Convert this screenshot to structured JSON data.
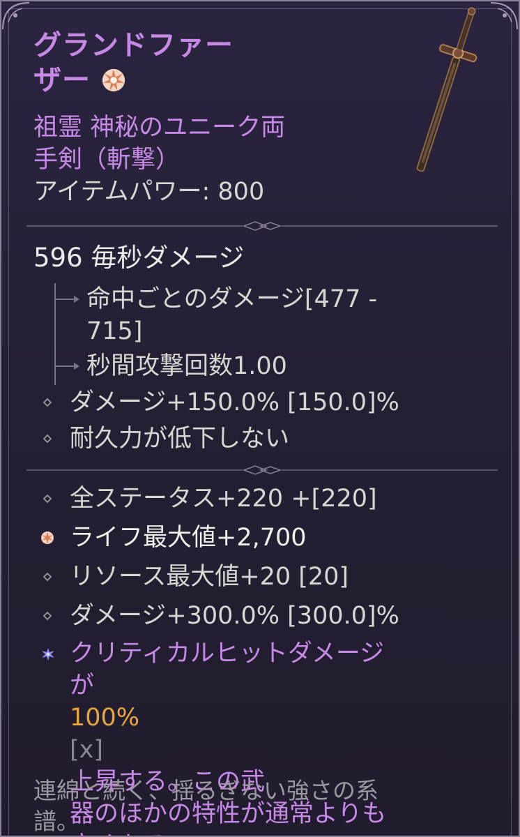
{
  "item": {
    "name_line1": "グランドファー",
    "name_line2": "ザー",
    "type_line1": "祖霊 神秘のユニーク両",
    "type_line2": "手剣（斬撃）",
    "item_power": "アイテムパワー: 800",
    "ancestral_icon": "ancestral-star-icon",
    "image_icon": "two-handed-sword-icon"
  },
  "damage": {
    "dps": "596 毎秒ダメージ",
    "per_hit_line1": "命中ごとのダメージ[477 -",
    "per_hit_line2": "715]",
    "attacks_per_second": "秒間攻撃回数1.00"
  },
  "implicits": [
    "ダメージ+150.0% [150.0]%",
    "耐久力が低下しない"
  ],
  "affixes": [
    "全ステータス+220 +[220]",
    "ライフ最大値+2,700",
    "リソース最大値+20 [20]",
    "ダメージ+300.0% [300.0]%"
  ],
  "unique_power": {
    "line1": "クリティカルヒットダメージ",
    "line2_a": "が",
    "line2_value": "100%",
    "line2_x": "[x]",
    "line2_b": "上昇する。この武",
    "line3": "器のほかの特性が通常よりも",
    "line4": "高くなる。"
  },
  "flavor": {
    "line1": "連綿と続く、揺るぎない強さの系",
    "line2": "譜。"
  },
  "colors": {
    "unique_name": "#c689e6",
    "value_highlight": "#e8a53c",
    "greater_affix": "#e07a52",
    "unique_bullet": "#8f8af0",
    "background": "#241f33"
  }
}
